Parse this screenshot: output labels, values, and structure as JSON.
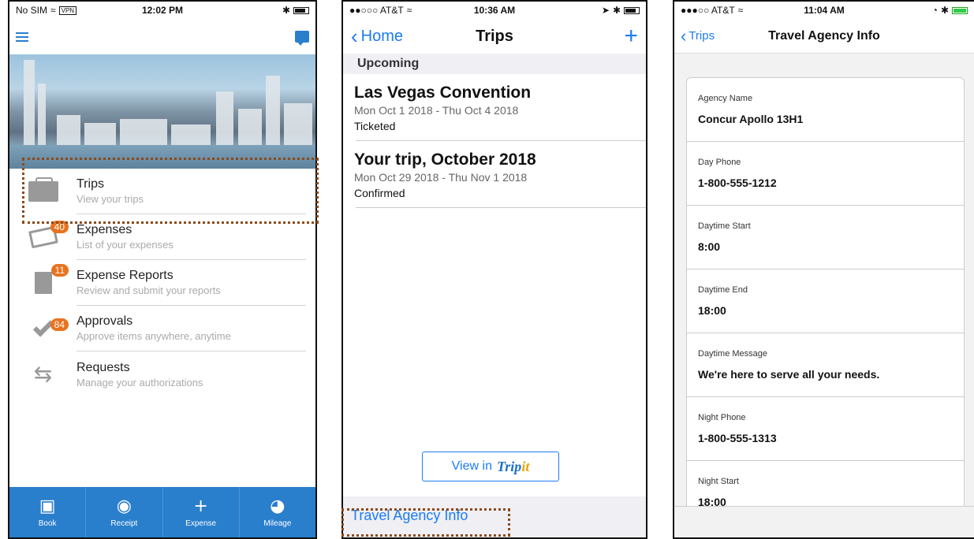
{
  "phone1": {
    "status": {
      "left": "No SIM",
      "vpn": "VPN",
      "time": "12:02 PM"
    },
    "menu": [
      {
        "title": "Trips",
        "sub": "View your trips",
        "badge": "",
        "icon": "briefcase-icon"
      },
      {
        "title": "Expenses",
        "sub": "List of your expenses",
        "badge": "40",
        "icon": "card-icon"
      },
      {
        "title": "Expense Reports",
        "sub": "Review and submit your reports",
        "badge": "11",
        "icon": "report-icon"
      },
      {
        "title": "Approvals",
        "sub": "Approve items anywhere, anytime",
        "badge": "84",
        "icon": "check-icon"
      },
      {
        "title": "Requests",
        "sub": "Manage your authorizations",
        "badge": "",
        "icon": "arrows-icon"
      }
    ],
    "tabs": [
      {
        "label": "Book",
        "icon": "briefcase-icon"
      },
      {
        "label": "Receipt",
        "icon": "camera-icon"
      },
      {
        "label": "Expense",
        "icon": "plus-icon"
      },
      {
        "label": "Mileage",
        "icon": "speedometer-icon"
      }
    ],
    "accent": "#2a7fcc",
    "badge_color": "#e8731f"
  },
  "phone2": {
    "status": {
      "carrier": "●●○○○ AT&T",
      "time": "10:36 AM"
    },
    "nav": {
      "back": "Home",
      "title": "Trips",
      "add": "+"
    },
    "section": "Upcoming",
    "trips": [
      {
        "title": "Las Vegas Convention",
        "dates": "Mon Oct 1 2018 - Thu Oct 4 2018",
        "status": "Ticketed"
      },
      {
        "title": "Your trip, October 2018",
        "dates": "Mon Oct 29 2018 - Thu Nov 1 2018",
        "status": "Confirmed"
      }
    ],
    "view_in": "View in",
    "tripit_a": "Trip",
    "tripit_b": "it",
    "agency_link": "Travel Agency Info"
  },
  "phone3": {
    "status": {
      "carrier": "●●●○○ AT&T",
      "time": "11:04 AM"
    },
    "nav": {
      "back": "Trips",
      "title": "Travel Agency Info"
    },
    "fields": [
      {
        "label": "Agency Name",
        "value": "Concur Apollo 13H1"
      },
      {
        "label": "Day Phone",
        "value": "1-800-555-1212"
      },
      {
        "label": "Daytime Start",
        "value": "8:00"
      },
      {
        "label": "Daytime End",
        "value": "18:00"
      },
      {
        "label": "Daytime Message",
        "value": "We're here to serve all your needs."
      },
      {
        "label": "Night Phone",
        "value": "1-800-555-1313"
      },
      {
        "label": "Night Start",
        "value": "18:00"
      }
    ]
  }
}
